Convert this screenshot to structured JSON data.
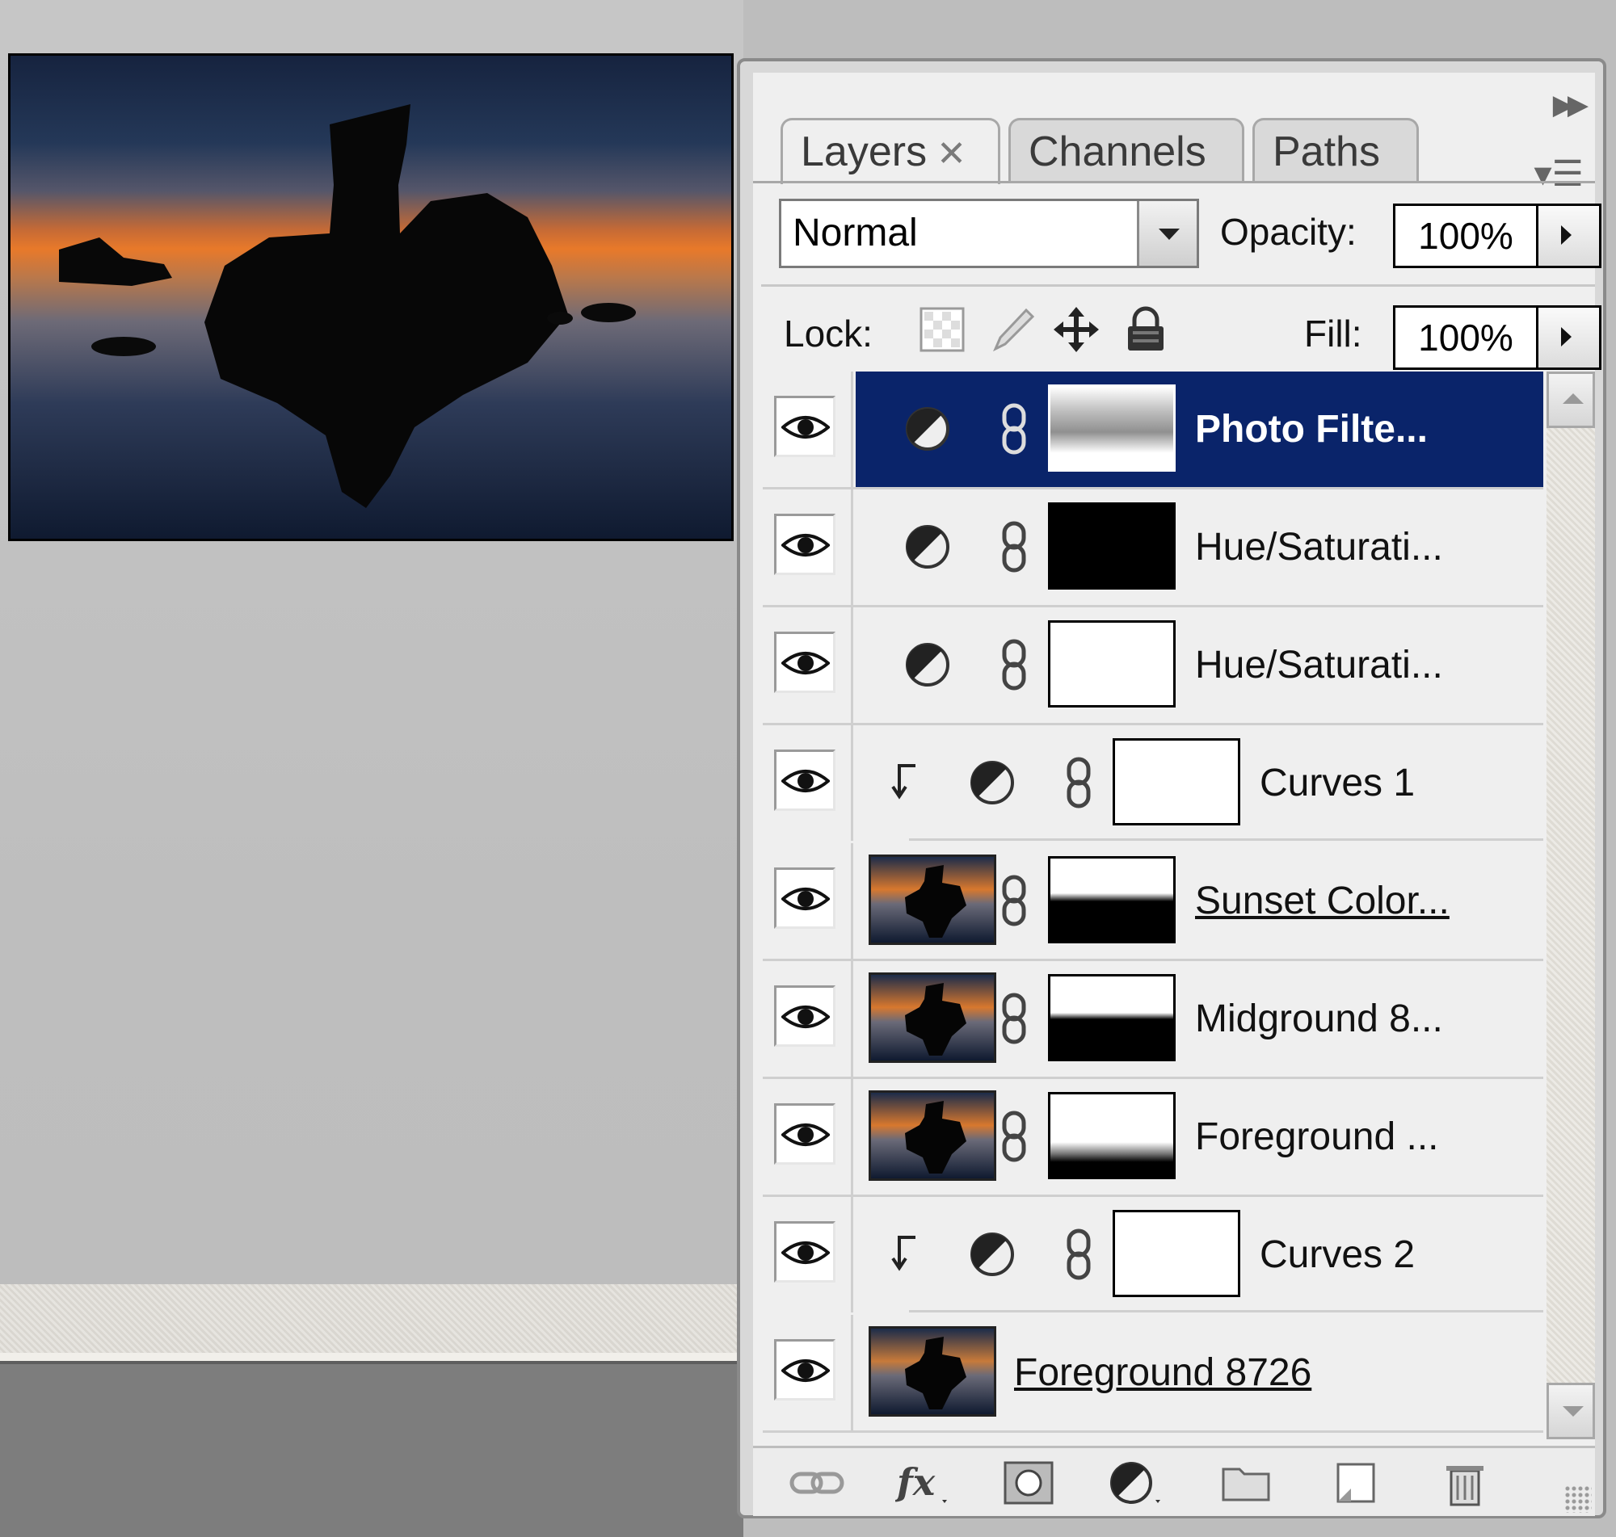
{
  "tabs": [
    {
      "label": "Layers",
      "active": true
    },
    {
      "label": "Channels",
      "active": false
    },
    {
      "label": "Paths",
      "active": false
    }
  ],
  "blend_mode": {
    "value": "Normal"
  },
  "opacity": {
    "label": "Opacity:",
    "value": "100%"
  },
  "lock": {
    "label": "Lock:"
  },
  "fill": {
    "label": "Fill:",
    "value": "100%"
  },
  "layers": [
    {
      "name": "Photo Filte...",
      "type": "adjustment",
      "selected": true,
      "mask": "photo-filter-mask"
    },
    {
      "name": "Hue/Saturati...",
      "type": "adjustment",
      "selected": false,
      "mask": "black-mask"
    },
    {
      "name": "Hue/Saturati...",
      "type": "adjustment",
      "selected": false,
      "mask": "white-mask"
    },
    {
      "name": "Curves 1",
      "type": "adjustment-clipped",
      "selected": false,
      "mask": "white-mask"
    },
    {
      "name": "Sunset Color...",
      "type": "image",
      "selected": false,
      "mask": "half-mask",
      "underlined": true
    },
    {
      "name": "Midground 8...",
      "type": "image",
      "selected": false,
      "mask": "half-mask"
    },
    {
      "name": "Foreground ...",
      "type": "image",
      "selected": false,
      "mask": "gradient-mask"
    },
    {
      "name": "Curves 2",
      "type": "adjustment-clipped",
      "selected": false,
      "mask": "white-mask"
    },
    {
      "name": "Foreground 8726",
      "type": "image-nomask",
      "selected": false,
      "underlined": true
    }
  ],
  "icons": [
    "eye-icon",
    "adjustment-icon",
    "chain-link-icon",
    "clip-arrow-icon",
    "lock-transparent-icon",
    "lock-paint-icon",
    "lock-move-icon",
    "lock-all-icon",
    "link-layers-icon",
    "fx-icon",
    "add-mask-icon",
    "new-adjustment-icon",
    "new-group-icon",
    "new-layer-icon",
    "trash-icon"
  ],
  "colors": {
    "selection": "#0a246a",
    "sky_top": "#1b2a48",
    "sunset_orange": "#e8792a"
  }
}
